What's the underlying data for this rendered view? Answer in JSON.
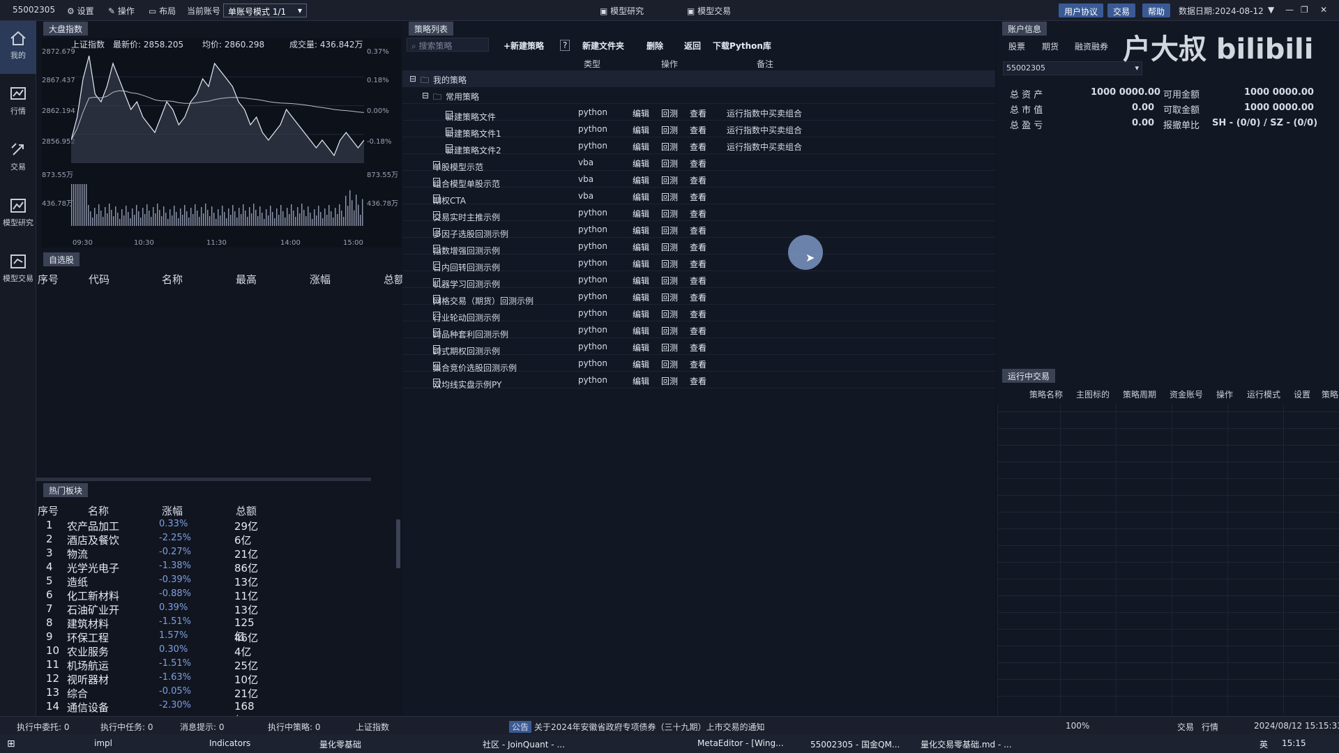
{
  "topbar": {
    "account": "55002305",
    "settings": "设置",
    "operate": "操作",
    "layout": "布局",
    "current_account": "当前账号",
    "mode_select": "单账号模式 1/1",
    "tab_research": "模型研究",
    "tab_trade": "模型交易",
    "btn_agreement": "用户协议",
    "btn_trade": "交易",
    "btn_help": "帮助",
    "data_date": "数据日期:2024-08-12"
  },
  "sidebar": {
    "items": [
      {
        "label": "我的",
        "icon": "home-icon"
      },
      {
        "label": "行情",
        "icon": "chart-icon"
      },
      {
        "label": "交易",
        "icon": "trade-icon"
      },
      {
        "label": "模型研究",
        "icon": "research-icon"
      },
      {
        "label": "模型交易",
        "icon": "model-trade-icon"
      }
    ]
  },
  "market": {
    "panel_title": "大盘指数",
    "index_name": "上证指数",
    "latest_label": "最新价: 2858.205",
    "avg_label": "均价: 2860.298",
    "vol_label": "成交量: 436.842万",
    "y_left": [
      "2872.679",
      "2867.437",
      "2862.194",
      "2856.952",
      "873.55万",
      "436.78万"
    ],
    "y_right": [
      "0.37%",
      "0.18%",
      "0.00%",
      "-0.18%",
      "873.55万",
      "436.78万"
    ],
    "x_ticks": [
      "09:30",
      "10:30",
      "11:30",
      "14:00",
      "15:00"
    ],
    "price_series": [
      2858,
      2861,
      2866,
      2869,
      2864,
      2863,
      2865,
      2868,
      2866,
      2864,
      2862,
      2863,
      2861,
      2860,
      2859,
      2861,
      2863,
      2862,
      2860,
      2861,
      2863,
      2864,
      2866,
      2865,
      2868,
      2867,
      2866,
      2865,
      2863,
      2862,
      2860,
      2861,
      2859,
      2858,
      2859,
      2860,
      2862,
      2861,
      2860,
      2859,
      2858,
      2857,
      2858,
      2857,
      2856,
      2858,
      2859,
      2858,
      2857,
      2858
    ]
  },
  "watchlist": {
    "panel_title": "自选股",
    "headers": [
      "序号",
      "代码",
      "名称",
      "最高",
      "涨幅",
      "总额"
    ]
  },
  "hot": {
    "panel_title": "热门板块",
    "headers": [
      "序号",
      "名称",
      "涨幅",
      "总额"
    ],
    "rows": [
      {
        "n": "1",
        "name": "农产品加工",
        "chg": "0.33%",
        "amt": "29亿"
      },
      {
        "n": "2",
        "name": "酒店及餐饮",
        "chg": "-2.25%",
        "amt": "6亿"
      },
      {
        "n": "3",
        "name": "物流",
        "chg": "-0.27%",
        "amt": "21亿"
      },
      {
        "n": "4",
        "name": "光学光电子",
        "chg": "-1.38%",
        "amt": "86亿"
      },
      {
        "n": "5",
        "name": "造纸",
        "chg": "-0.39%",
        "amt": "13亿"
      },
      {
        "n": "6",
        "name": "化工新材料",
        "chg": "-0.88%",
        "amt": "11亿"
      },
      {
        "n": "7",
        "name": "石油矿业开",
        "chg": "0.39%",
        "amt": "13亿"
      },
      {
        "n": "8",
        "name": "建筑材料",
        "chg": "-1.51%",
        "amt": "125亿"
      },
      {
        "n": "9",
        "name": "环保工程",
        "chg": "1.57%",
        "amt": "46亿"
      },
      {
        "n": "10",
        "name": "农业服务",
        "chg": "0.30%",
        "amt": "4亿"
      },
      {
        "n": "11",
        "name": "机场航运",
        "chg": "-1.51%",
        "amt": "25亿"
      },
      {
        "n": "12",
        "name": "视听器材",
        "chg": "-1.63%",
        "amt": "10亿"
      },
      {
        "n": "13",
        "name": "综合",
        "chg": "-0.05%",
        "amt": "21亿"
      },
      {
        "n": "14",
        "name": "通信设备",
        "chg": "-2.30%",
        "amt": "168亿"
      }
    ]
  },
  "strategy": {
    "panel_title": "策略列表",
    "search_placeholder": "搜索策略",
    "new_strategy": "+新建策略",
    "help": "?",
    "new_folder": "新建文件夹",
    "delete": "删除",
    "back": "返回",
    "download": "下载Python库",
    "col_type": "类型",
    "col_op": "操作",
    "col_note": "备注",
    "root": "我的策略",
    "common": "常用策略",
    "op_edit": "编辑",
    "op_back": "回测",
    "op_view": "查看",
    "rows": [
      {
        "name": "新建策略文件",
        "type": "python",
        "note": "运行指数中买卖组合"
      },
      {
        "name": "新建策略文件1",
        "type": "python",
        "note": "运行指数中买卖组合"
      },
      {
        "name": "新建策略文件2",
        "type": "python",
        "note": "运行指数中买卖组合"
      },
      {
        "name": "单股模型示范",
        "type": "vba",
        "note": ""
      },
      {
        "name": "组合模型单股示范",
        "type": "vba",
        "note": ""
      },
      {
        "name": "期权CTA",
        "type": "vba",
        "note": ""
      },
      {
        "name": "交易实时主推示例",
        "type": "python",
        "note": ""
      },
      {
        "name": "多因子选股回测示例",
        "type": "python",
        "note": ""
      },
      {
        "name": "指数增强回测示例",
        "type": "python",
        "note": ""
      },
      {
        "name": "日内回转回测示例",
        "type": "python",
        "note": ""
      },
      {
        "name": "机器学习回测示例",
        "type": "python",
        "note": ""
      },
      {
        "name": "网格交易（期货）回测示例",
        "type": "python",
        "note": ""
      },
      {
        "name": "行业轮动回测示例",
        "type": "python",
        "note": ""
      },
      {
        "name": "跨品种套利回测示例",
        "type": "python",
        "note": ""
      },
      {
        "name": "跨式期权回测示例",
        "type": "python",
        "note": ""
      },
      {
        "name": "集合竞价选股回测示例",
        "type": "python",
        "note": ""
      },
      {
        "name": "双均线实盘示例PY",
        "type": "python",
        "note": ""
      }
    ]
  },
  "account": {
    "panel_title": "账户信息",
    "tabs": [
      "股票",
      "期货",
      "融资融券"
    ],
    "account_select": "55002305",
    "total_assets_label": "总 资 产",
    "total_assets": "1000 0000.00",
    "available_label": "可用金额",
    "available": "1000 0000.00",
    "market_value_label": "总 市 值",
    "market_value": "0.00",
    "withdrawable_label": "可取金额",
    "withdrawable": "1000 0000.00",
    "pnl_label": "总 盈 亏",
    "pnl": "0.00",
    "cancel_label": "报撤单比",
    "cancel": "SH - (0/0) / SZ - (0/0)"
  },
  "logo": "户大叔 bilibili",
  "running": {
    "panel_title": "运行中交易",
    "headers": [
      "策略名称",
      "主图标的",
      "策略周期",
      "资金账号",
      "操作",
      "运行模式",
      "设置",
      "策略"
    ]
  },
  "status": {
    "exec_orders": "执行中委托: 0",
    "exec_tasks": "执行中任务: 0",
    "msg": "消息提示: 0",
    "exec_strategies": "执行中策略: 0",
    "index": "上证指数",
    "notice_tag": "公告",
    "notice": "关于2024年安徽省政府专项债券（三十九期）上市交易的通知",
    "zoom": "100%",
    "trade": "交易",
    "quote": "行情",
    "datetime": "2024/08/12 15:15:33"
  },
  "taskbar": {
    "items": [
      "impl",
      "Indicators",
      "量化零基础",
      "社区 - JoinQuant - ...",
      "MetaEditor - [Wing...",
      "55002305 - 国金QM...",
      "量化交易零基础.md - ..."
    ],
    "ime": "英",
    "time": "15:15"
  }
}
